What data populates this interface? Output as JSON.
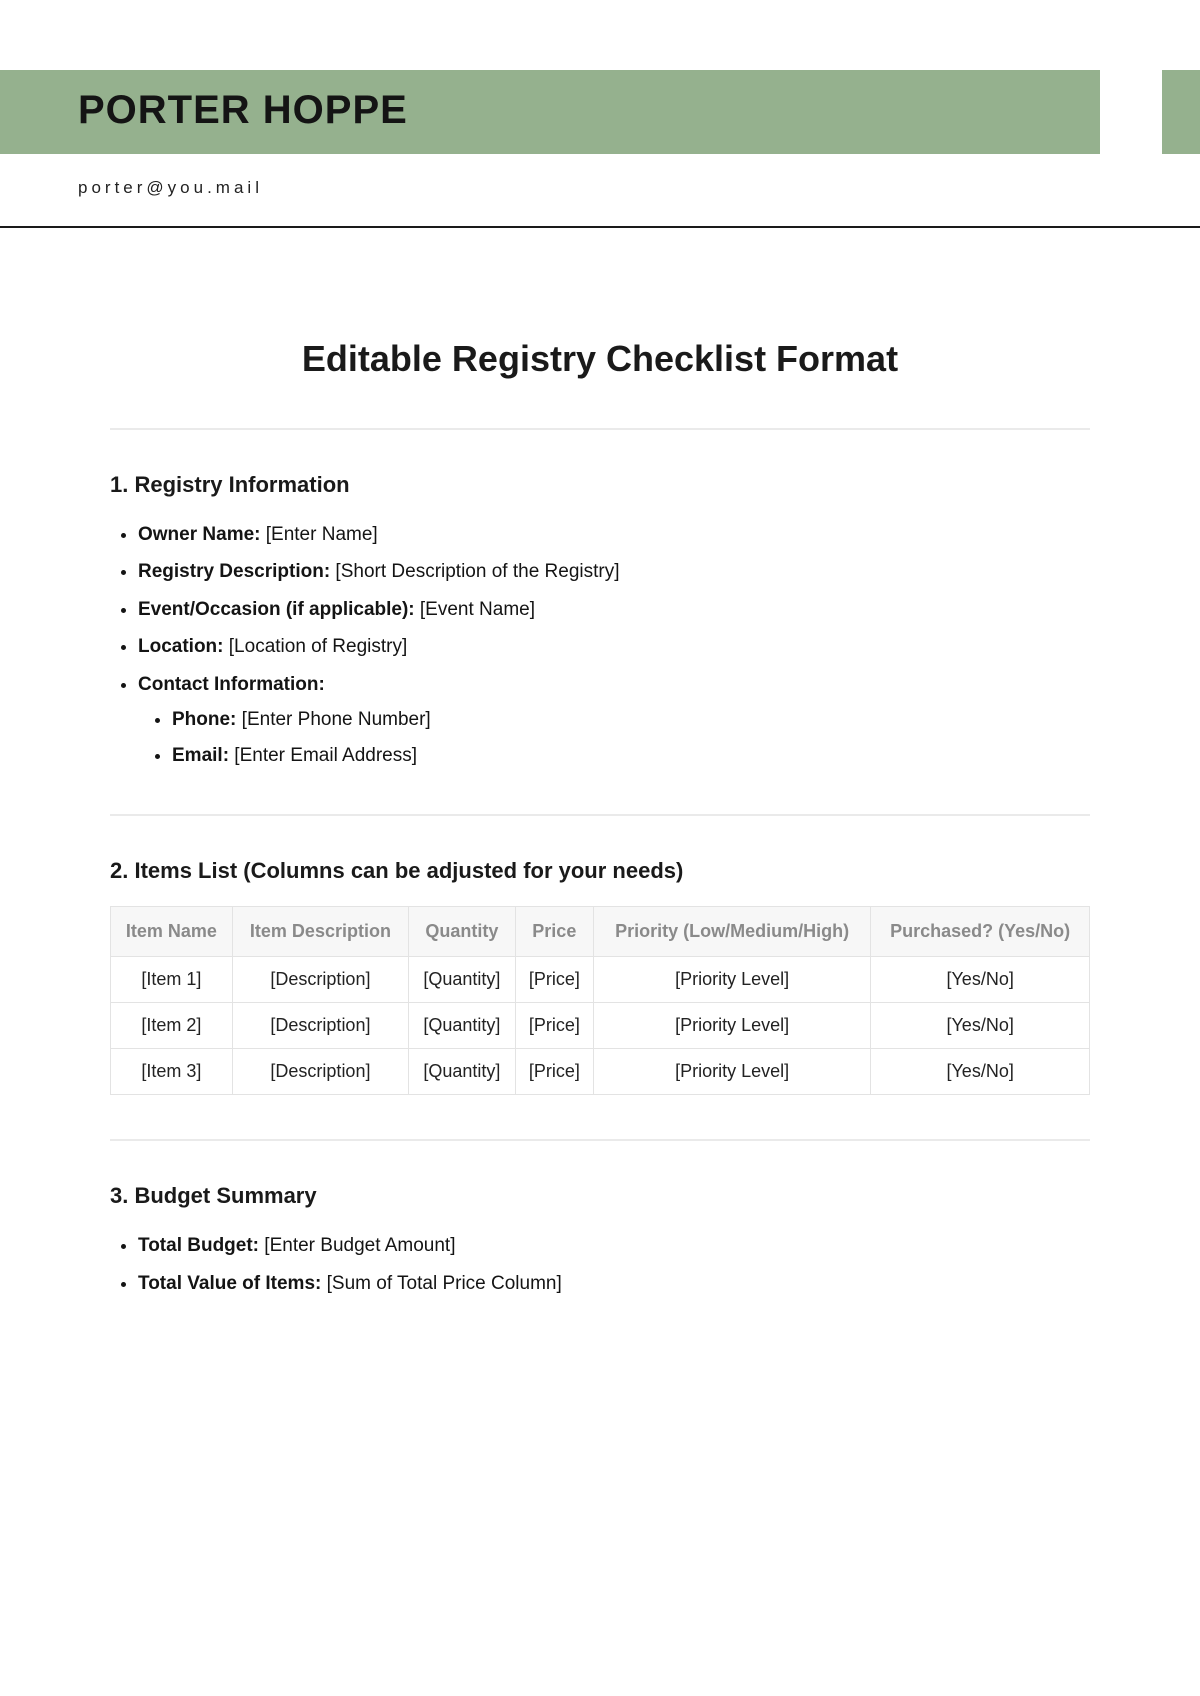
{
  "header": {
    "brand": "PORTER HOPPE",
    "email": "porter@you.mail"
  },
  "title": "Editable Registry Checklist Format",
  "section1": {
    "heading": "1. Registry Information",
    "owner_label": "Owner Name:",
    "owner_value": " [Enter Name]",
    "desc_label": "Registry Description:",
    "desc_value": " [Short Description of the Registry]",
    "event_label": "Event/Occasion (if applicable):",
    "event_value": " [Event Name]",
    "loc_label": "Location:",
    "loc_value": " [Location of Registry]",
    "contact_label": "Contact Information:",
    "phone_label": "Phone:",
    "phone_value": " [Enter Phone Number]",
    "email_label": "Email:",
    "email_value": " [Enter Email Address]"
  },
  "section2": {
    "heading": "2. Items List (Columns can be adjusted for your needs)",
    "headers": [
      "Item Name",
      "Item Description",
      "Quantity",
      "Price",
      "Priority (Low/Medium/High)",
      "Purchased? (Yes/No)"
    ],
    "rows": [
      [
        "[Item 1]",
        "[Description]",
        "[Quantity]",
        "[Price]",
        "[Priority Level]",
        "[Yes/No]"
      ],
      [
        "[Item 2]",
        "[Description]",
        "[Quantity]",
        "[Price]",
        "[Priority Level]",
        "[Yes/No]"
      ],
      [
        "[Item 3]",
        "[Description]",
        "[Quantity]",
        "[Price]",
        "[Priority Level]",
        "[Yes/No]"
      ]
    ]
  },
  "section3": {
    "heading": "3. Budget Summary",
    "budget_label": "Total Budget:",
    "budget_value": " [Enter Budget Amount]",
    "totalval_label": "Total Value of Items:",
    "totalval_value": " [Sum of Total Price Column]"
  }
}
